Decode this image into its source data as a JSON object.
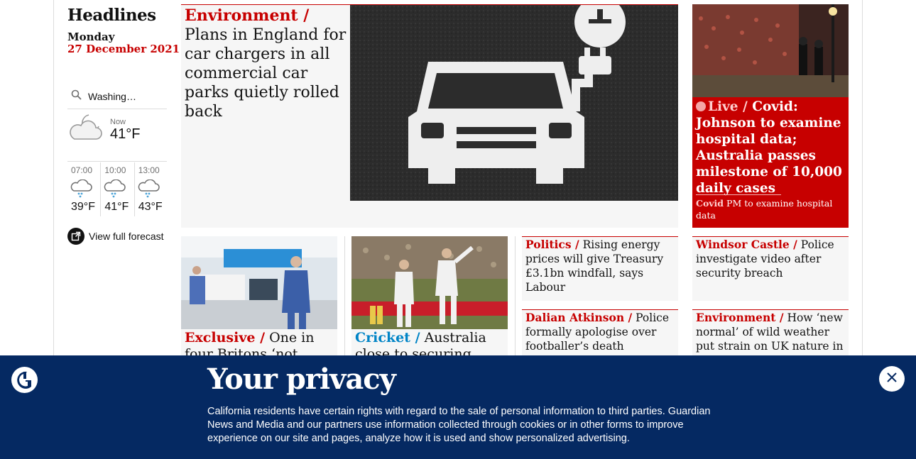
{
  "sidebar": {
    "title": "Headlines",
    "day": "Monday",
    "date": "27 December 2021",
    "weather": {
      "location": "Washing…",
      "now_label": "Now",
      "now_temp": "41°F",
      "forecast": [
        {
          "time": "07:00",
          "temp": "39°F",
          "icon": "rain-cloud-icon"
        },
        {
          "time": "10:00",
          "temp": "41°F",
          "icon": "rain-cloud-icon"
        },
        {
          "time": "13:00",
          "temp": "43°F",
          "icon": "rain-cloud-icon"
        }
      ],
      "full_forecast_label": "View full forecast"
    }
  },
  "main_story": {
    "kicker": "Environment /",
    "headline": "Plans in England for car chargers in all commercial car parks quietly rolled back"
  },
  "live_story": {
    "live_label": "Live /",
    "headline": "Covid: Johnson to examine hospital data; Australia passes milestone of 10,000 daily cases",
    "sub_kicker": "Covid",
    "sub_text": "PM to examine hospital data"
  },
  "stories": [
    {
      "kicker": "Exclusive /",
      "headline": "One in four Britons ‘not confident"
    },
    {
      "kicker": "Cricket /",
      "headline": "Australia close to securing Ashes"
    },
    {
      "kicker": "Politics /",
      "headline": "Rising energy prices will give Treasury £3.1bn windfall, says Labour"
    },
    {
      "kicker": "Windsor Castle /",
      "headline": "Police investigate video after security breach"
    },
    {
      "kicker": "Dalian Atkinson /",
      "headline": "Police formally apologise over footballer’s death"
    },
    {
      "kicker": "Environment /",
      "headline": "How ‘new normal’ of wild weather put strain on UK nature in"
    }
  ],
  "privacy": {
    "title": "Your privacy",
    "body": "California residents have certain rights with regard to the sale of personal information to third parties. Guardian News and Media and our partners use information collected through cookies or in other forms to improve experience on our site and pages, analyze how it is used and show personalized advertising."
  },
  "colors": {
    "brand_red": "#c70000",
    "brand_navy": "#052962",
    "cricket_blue": "#0084c6"
  }
}
